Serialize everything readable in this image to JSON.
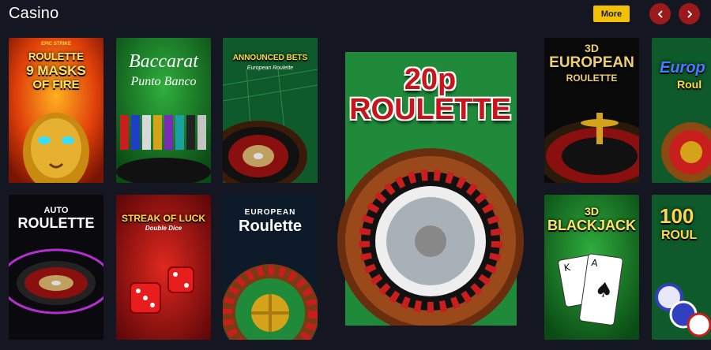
{
  "section": {
    "title": "Casino",
    "more_label": "More"
  },
  "nav": {
    "prev_icon": "chevron-left-icon",
    "next_icon": "chevron-right-icon"
  },
  "colors": {
    "background": "#141722",
    "accent": "#f2c200",
    "nav": "#9b1b1b"
  },
  "games": {
    "epic_roulette": {
      "top": "EPIC STRIKE",
      "line1": "ROULETTE",
      "line2": "9 MASKS",
      "line3": "OF FIRE"
    },
    "baccarat": {
      "line1": "Baccarat",
      "line2": "Punto Banco"
    },
    "announced_bets": {
      "line1": "ANNOUNCED BETS",
      "line2": "European Roulette"
    },
    "roulette_20p": {
      "line1": "20p ROULETTE"
    },
    "roulette_3d_european": {
      "line1": "3D",
      "line2": "EUROPEAN",
      "line3": "ROULETTE"
    },
    "european_roulette_partial": {
      "line1": "Europ",
      "line2": "Roul"
    },
    "auto_roulette": {
      "line1": "AUTO",
      "line2": "ROULETTE"
    },
    "streak_of_luck": {
      "line1": "STREAK OF LUCK",
      "line2": "Double Dice"
    },
    "european_roulette": {
      "line1": "EUROPEAN",
      "line2": "Roulette"
    },
    "blackjack_3d": {
      "line1": "3D",
      "line2": "BLACKJACK"
    },
    "roulette_100_partial": {
      "line1": "100",
      "line2": "ROUL"
    }
  }
}
